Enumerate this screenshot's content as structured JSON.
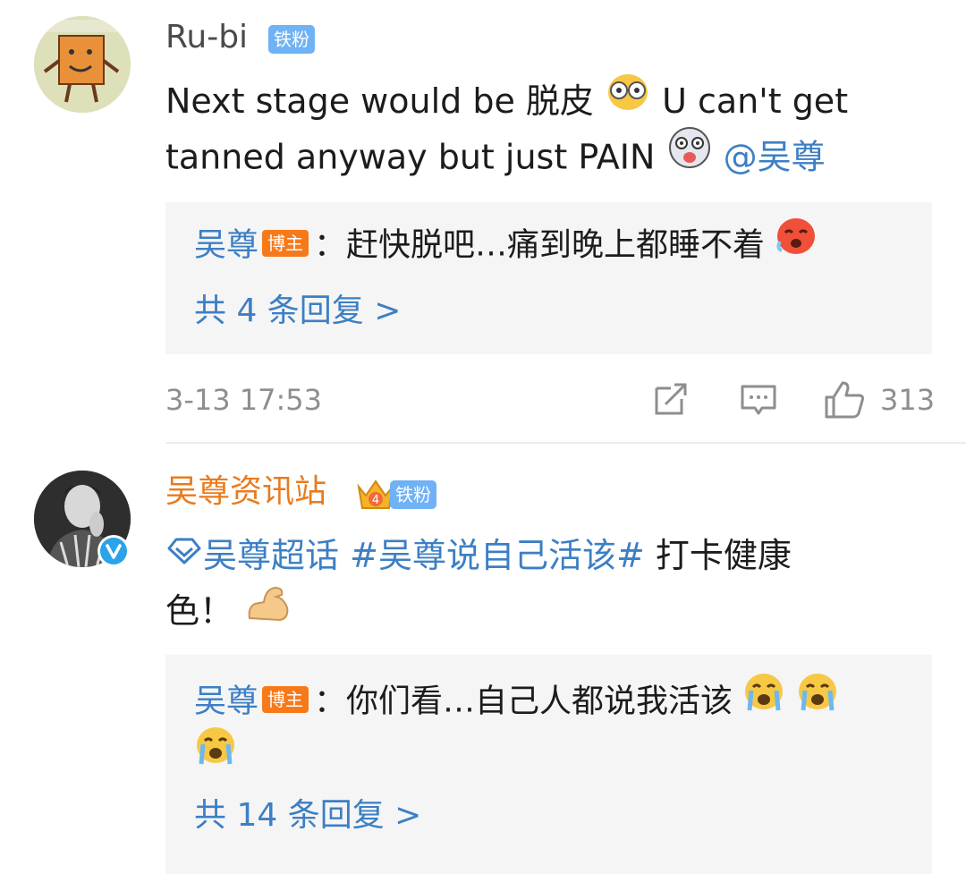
{
  "comments": [
    {
      "username": "Ru-bi",
      "fan_badge": "铁粉",
      "text_line1": "Next stage would be 脱皮",
      "text_line1_after": "U can't get",
      "text_line2": "tanned anyway but just PAIN",
      "mention": "@吴尊",
      "emoji1": "face-with-monocle-glasses-icon",
      "emoji2": "dizzy-tongue-face-icon",
      "reply": {
        "author": "吴尊",
        "host_badge": "博主",
        "text": "：赶快脱吧…痛到晚上都睡不着",
        "emoji": "hot-face-icon",
        "count_label": "共 4 条回复 >"
      },
      "timestamp": "3-13 17:53",
      "like_count": "313",
      "actions": [
        "share-icon",
        "comment-icon",
        "like-icon"
      ]
    },
    {
      "username": "吴尊资讯站",
      "fan_badge": "铁粉",
      "crown_level": "4",
      "topic_super": "吴尊超话",
      "topic_hashtag": "#吴尊说自己活该#",
      "text_after": " 打卡健康",
      "text_line2": "色！",
      "emoji": "flexed-biceps-icon",
      "reply": {
        "author": "吴尊",
        "host_badge": "博主",
        "text": "：你们看…自己人都说我活该",
        "emoji": "loudly-crying-face-icon",
        "count_label": "共 14 条回复 >"
      }
    }
  ],
  "colors": {
    "link_blue": "#3d7fc4",
    "username_orange": "#e97b1d",
    "host_badge_orange": "#f77a1a",
    "fan_badge_blue": "#6fb2f5",
    "reply_bg": "#f5f5f5",
    "meta_gray": "#8e8e8e"
  }
}
